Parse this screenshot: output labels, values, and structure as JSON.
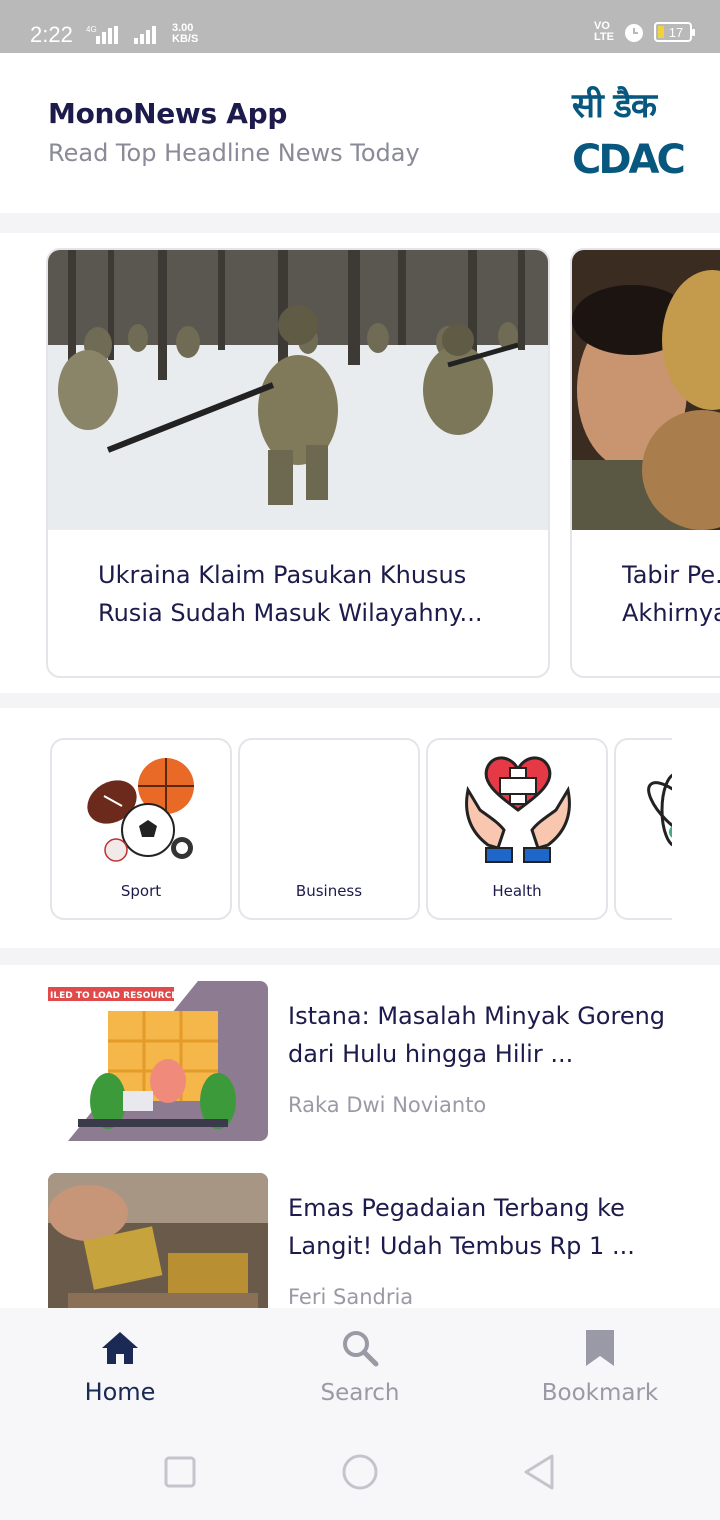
{
  "status_bar": {
    "time": "2:22",
    "network": "4G",
    "speed_value": "3.00",
    "speed_unit": "KB/S",
    "volte": "VO",
    "lte": "LTE",
    "battery": "17"
  },
  "header": {
    "title": "MonoNews App",
    "subtitle": "Read Top Headline News Today",
    "logo_hindi": "सी डैक",
    "logo_text": "CDAC"
  },
  "headlines": [
    {
      "title": "Ukraina Klaim Pasukan Khusus Rusia Sudah Masuk Wilayahny..."
    },
    {
      "title": "Tabir Pe... Akhirnya..."
    }
  ],
  "categories": [
    {
      "label": "Sport",
      "icon": "sports-balls-icon"
    },
    {
      "label": "Business",
      "icon": ""
    },
    {
      "label": "Health",
      "icon": "health-hands-heart-icon"
    },
    {
      "label": "",
      "icon": "science-atom-icon"
    }
  ],
  "articles": [
    {
      "title": "Istana: Masalah Minyak Goreng dari Hulu hingga Hilir ...",
      "author": "Raka Dwi Novianto",
      "image_banner": "ILED TO LOAD RESOURCE"
    },
    {
      "title": "Emas Pegadaian Terbang ke Langit! Udah Tembus Rp 1 ...",
      "author": "Feri Sandria"
    }
  ],
  "bottom_nav": {
    "home": "Home",
    "search": "Search",
    "bookmark": "Bookmark",
    "active": "home"
  },
  "colors": {
    "accent": "#1b2a55",
    "muted": "#9a9aa6",
    "logo": "#08577f"
  }
}
